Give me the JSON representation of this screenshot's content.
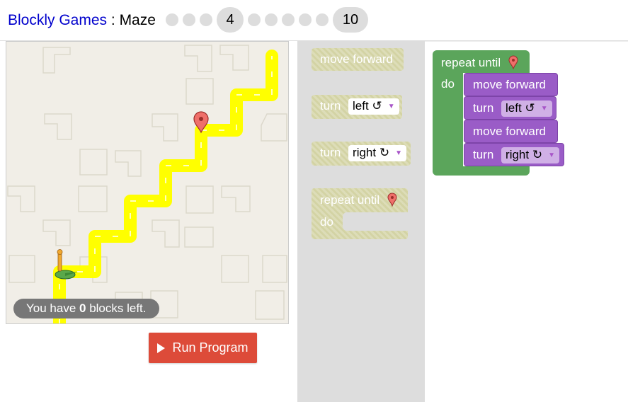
{
  "header": {
    "app_link": "Blockly Games",
    "separator": " : ",
    "game_name": "Maze",
    "current_level": "4",
    "last_level": "10"
  },
  "maze": {
    "capacity_prefix": "You have ",
    "capacity_count": "0",
    "capacity_suffix": " blocks left."
  },
  "run_button": {
    "label": "Run Program"
  },
  "toolbox": {
    "move_forward": "move forward",
    "turn_label": "turn",
    "left_option": "left ↺",
    "right_option": "right ↻",
    "repeat_until": "repeat until",
    "do_label": "do"
  },
  "workspace": {
    "repeat_until": "repeat until",
    "do_label": "do",
    "move_forward_1": "move forward",
    "turn_1": "turn",
    "turn_1_value": "left ↺",
    "move_forward_2": "move forward",
    "turn_2": "turn",
    "turn_2_value": "right ↻"
  },
  "colors": {
    "accent_link": "#0000cc",
    "run_button": "#dd4b39",
    "path": "#ffff00",
    "movement_block": "#9a5cc7",
    "loop_block": "#5ba55b",
    "disabled_block": "#d3d3a4"
  },
  "icons": [
    "map-marker-icon",
    "pegman-icon",
    "play-triangle-icon",
    "dropdown-arrow-icon"
  ]
}
